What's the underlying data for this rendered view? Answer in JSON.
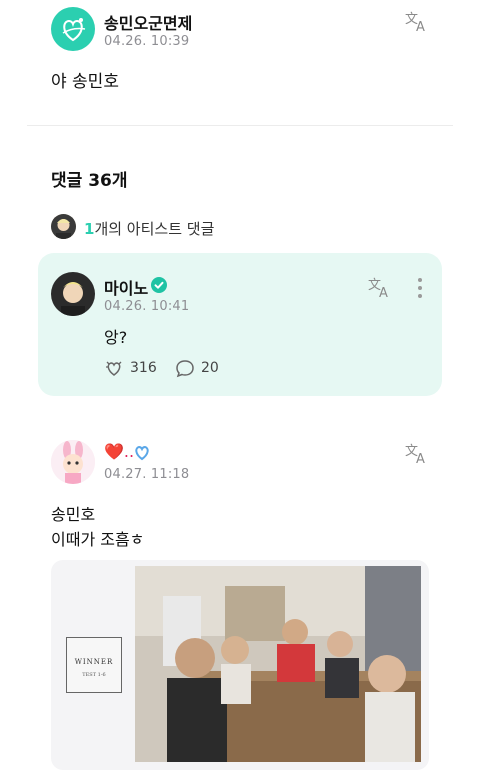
{
  "post": {
    "author": "송민오군면제",
    "time": "04.26. 10:39",
    "text": "야 송민호"
  },
  "comments_header": {
    "title": "댓글 36개"
  },
  "artist_summary": {
    "count": "1",
    "label": "개의 아티스트 댓글"
  },
  "artist_comment": {
    "author": "마이노",
    "time": "04.26. 10:41",
    "text": "앙?",
    "likes": "316",
    "replies": "20"
  },
  "comment2": {
    "author_emoji": "❤️..",
    "time": "04.27. 11:18",
    "line1": "송민호",
    "line2": "이때가 조흠ㅎ"
  },
  "album": {
    "title": "WINNER",
    "subtitle": "TEST 1-6"
  },
  "colors": {
    "accent": "#2bcfb0",
    "artist_bg": "#e6f8f3",
    "verified": "#1fc3a4"
  },
  "icons": {
    "translate": "translate-icon",
    "more": "more-vertical-icon",
    "like": "heart-cheer-icon",
    "reply": "comment-bubble-icon",
    "verified": "verified-badge-icon"
  }
}
